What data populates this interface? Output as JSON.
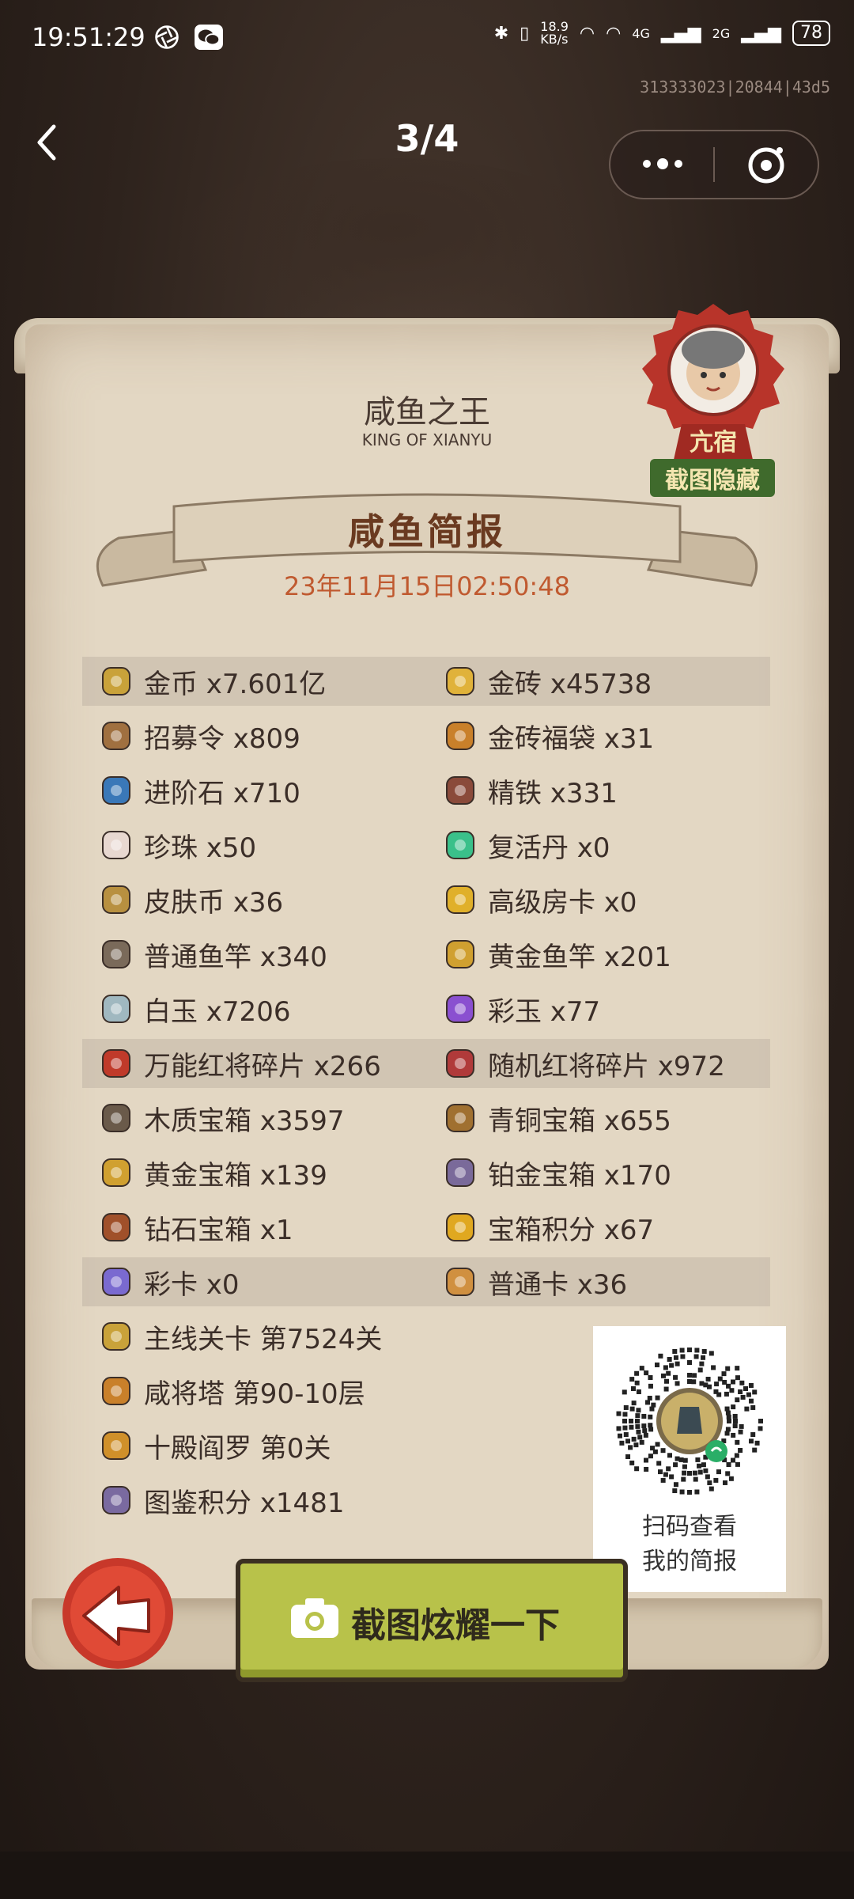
{
  "status_bar": {
    "time": "19:51:29",
    "network_speed": "18.9\nKB/s",
    "signal_4g": "4G",
    "signal_2g": "2G",
    "battery": "78"
  },
  "watermark": "313333023|20844|43d5",
  "header": {
    "title": "3/4"
  },
  "scroll": {
    "title": "咸鱼之王",
    "title_en": "KING OF XIANYU",
    "ribbon": "咸鱼简报",
    "date": "23年11月15日02:50:48"
  },
  "badge": {
    "name": "亢宿",
    "hide_label": "截图隐藏"
  },
  "items": [
    {
      "left": "金币 x7.601亿",
      "left_icon": "gold-coin-icon",
      "right": "金砖 x45738",
      "right_icon": "gold-brick-icon",
      "highlight": true
    },
    {
      "left": "招募令 x809",
      "left_icon": "recruit-token-icon",
      "right": "金砖福袋 x31",
      "right_icon": "gold-bag-icon",
      "highlight": false
    },
    {
      "left": "进阶石 x710",
      "left_icon": "advance-stone-icon",
      "right": "精铁 x331",
      "right_icon": "refined-iron-icon",
      "highlight": false
    },
    {
      "left": "珍珠 x50",
      "left_icon": "pearl-icon",
      "right": "复活丹 x0",
      "right_icon": "revive-pill-icon",
      "highlight": false
    },
    {
      "left": "皮肤币 x36",
      "left_icon": "skin-coin-icon",
      "right": "高级房卡 x0",
      "right_icon": "room-card-icon",
      "highlight": false
    },
    {
      "left": "普通鱼竿 x340",
      "left_icon": "fishing-rod-icon",
      "right": "黄金鱼竿 x201",
      "right_icon": "golden-rod-icon",
      "highlight": false
    },
    {
      "left": "白玉 x7206",
      "left_icon": "white-jade-icon",
      "right": "彩玉 x77",
      "right_icon": "color-jade-icon",
      "highlight": false
    },
    {
      "left": "万能红将碎片 x266",
      "left_icon": "red-fragment-chest-icon",
      "right": "随机红将碎片 x972",
      "right_icon": "random-fragment-chest-icon",
      "highlight": true
    },
    {
      "left": "木质宝箱 x3597",
      "left_icon": "wooden-chest-icon",
      "right": "青铜宝箱 x655",
      "right_icon": "bronze-chest-icon",
      "highlight": false
    },
    {
      "left": "黄金宝箱 x139",
      "left_icon": "golden-chest-icon",
      "right": "铂金宝箱 x170",
      "right_icon": "platinum-chest-icon",
      "highlight": false
    },
    {
      "left": "钻石宝箱 x1",
      "left_icon": "diamond-chest-icon",
      "right": "宝箱积分 x67",
      "right_icon": "chest-points-icon",
      "highlight": false
    },
    {
      "left": "彩卡 x0",
      "left_icon": "color-card-icon",
      "right": "普通卡 x36",
      "right_icon": "normal-card-icon",
      "highlight": true
    },
    {
      "left": "主线关卡 第7524关",
      "left_icon": "main-stage-icon",
      "right": "",
      "right_icon": "",
      "highlight": false
    },
    {
      "left": "咸将塔 第90-10层",
      "left_icon": "tower-icon",
      "right": "",
      "right_icon": "",
      "highlight": false
    },
    {
      "left": "十殿阎罗 第0关",
      "left_icon": "yama-icon",
      "right": "",
      "right_icon": "",
      "highlight": false
    },
    {
      "left": "图鉴积分 x1481",
      "left_icon": "codex-points-icon",
      "right": "",
      "right_icon": "",
      "highlight": false
    }
  ],
  "qr": {
    "line1": "扫码查看",
    "line2": "我的简报"
  },
  "share_button": "截图炫耀一下",
  "colors": {
    "parchment": "#e3d7c3",
    "text": "#3b2e28",
    "date": "#c05a30",
    "button": "#b8c24a",
    "badge": "#b8342a"
  }
}
